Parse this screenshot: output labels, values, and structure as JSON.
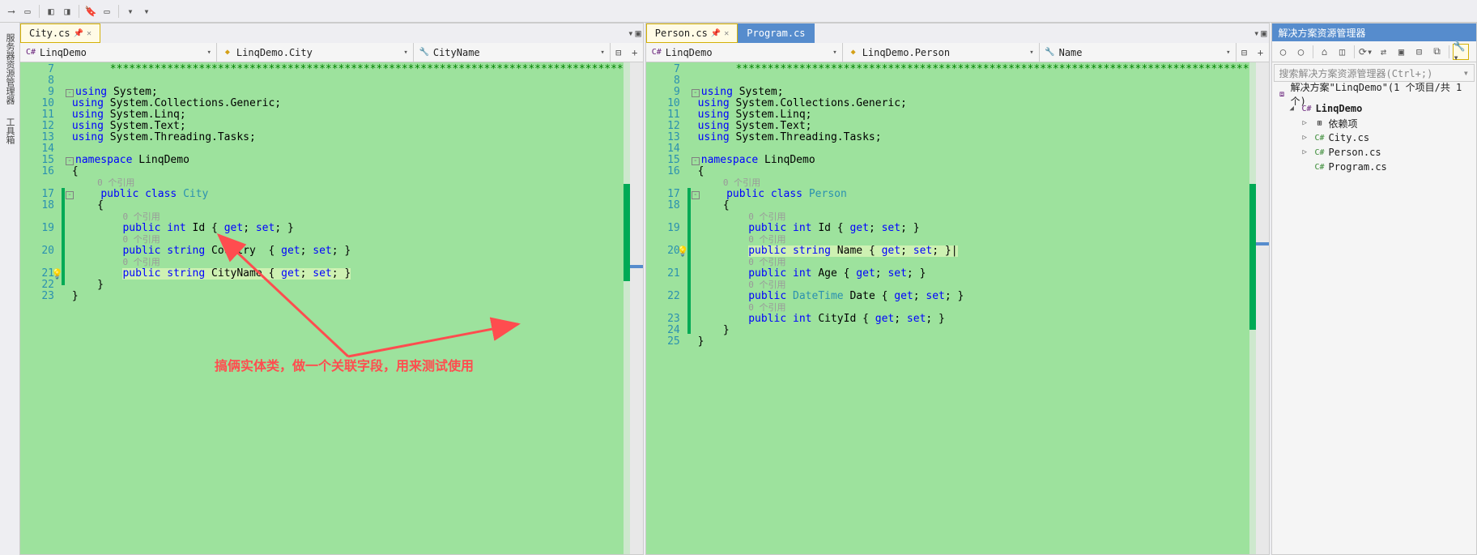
{
  "toolbar": {
    "icons": [
      "▭",
      "▭",
      "|",
      "◧",
      "◨",
      "|",
      "🔖",
      "▭",
      "|",
      "▾",
      "▾"
    ]
  },
  "sidebars": {
    "left": [
      "服务器资源管理器",
      "工具箱"
    ]
  },
  "pane1": {
    "tab": {
      "label": "City.cs",
      "pin": "📌",
      "close": "✕"
    },
    "nav": {
      "project": "LinqDemo",
      "class": "LinqDemo.City",
      "member": "CityName"
    },
    "gutter": [
      "7",
      "8",
      "9",
      "10",
      "11",
      "12",
      "13",
      "14",
      "15",
      "16",
      "",
      "17",
      "18",
      "",
      "19",
      "",
      "20",
      "",
      "21",
      "22",
      "23"
    ],
    "refs": "0 个引用"
  },
  "pane2": {
    "tabs": [
      {
        "label": "Person.cs",
        "active": true
      },
      {
        "label": "Program.cs",
        "active": false
      }
    ],
    "nav": {
      "project": "LinqDemo",
      "class": "LinqDemo.Person",
      "member": "Name"
    },
    "gutter": [
      "7",
      "8",
      "9",
      "10",
      "11",
      "12",
      "13",
      "14",
      "15",
      "16",
      "",
      "17",
      "18",
      "",
      "19",
      "",
      "20",
      "",
      "21",
      "",
      "22",
      "",
      "23",
      "24",
      "25"
    ],
    "refs": "0 个引用"
  },
  "solution": {
    "title": "解决方案资源管理器",
    "search_placeholder": "搜索解决方案资源管理器(Ctrl+;)",
    "root": "解决方案\"LinqDemo\"(1 个项目/共 1 个)",
    "project": "LinqDemo",
    "deps": "依赖项",
    "files": [
      "City.cs",
      "Person.cs",
      "Program.cs"
    ]
  },
  "annotation": "搞俩实体类，做一个关联字段，用来测试使用"
}
